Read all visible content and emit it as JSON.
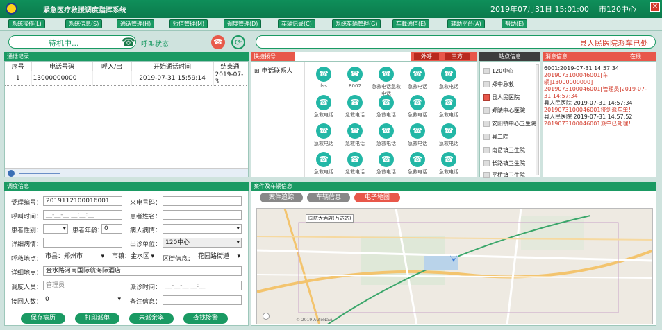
{
  "title_bar": {
    "app_title": "紧急医疗救援调度指挥系统",
    "datetime": "2019年07月31日 15:01:00",
    "center": "市120中心",
    "close_glyph": "✕"
  },
  "menu": [
    "系统操作(L)",
    "系统信息(S)",
    "通话管理(H)",
    "短信管理(M)",
    "调度管理(D)",
    "车辆记录(C)",
    "系统车辆管理(G)",
    "车载通信(E)",
    "辅助平台(A)",
    "帮助(E)"
  ],
  "status": {
    "waiting_text": "待机中...",
    "call_state": "呼叫状态",
    "notice": "县人民医院派车已处",
    "phone_icon": "☎",
    "hangup_icon": "☎",
    "refresh_icon": "⟳"
  },
  "call_records": {
    "header": "通话记录",
    "columns": [
      "序号",
      "电话号码",
      "呼入/出",
      "开始通话时间",
      "结束通"
    ],
    "rows": [
      {
        "no": "1",
        "phone": "13000000000",
        "direction": "",
        "start": "2019-07-31 15:59:14",
        "end": "2019-07-3"
      }
    ]
  },
  "quick_dial": {
    "label": "快捷拨号",
    "btn_out": "外呼",
    "btn_three": "三方",
    "contacts_label": "电话联系人",
    "items": [
      "fss",
      "8002",
      "急救电话急救电话",
      "急救电话",
      "急救电话",
      "急救电话",
      "急救电话",
      "急救电话",
      "急救电话",
      "急救电话",
      "急救电话",
      "急救电话",
      "急救电话",
      "急救电话",
      "急救电话",
      "急救电话",
      "急救电话",
      "急救电话",
      "急救电话",
      "急救电话"
    ]
  },
  "duty": {
    "header": "站点信息",
    "items": [
      "120中心",
      "郑中急救",
      "县人民医院",
      "郑陵中心医院",
      "安阳镇中心卫生院",
      "县二院",
      "南岳镇卫生院",
      "长路镇卫生院",
      "平桥镇卫生院"
    ]
  },
  "messages": {
    "header": "消息信息",
    "online": "在线",
    "lines": [
      {
        "text": "6001:2019-07-31 14:57:34",
        "kind": "b"
      },
      {
        "text": "2019073100046001[车辆]13000000000]",
        "kind": "r"
      },
      {
        "text": "2019073100046001[管理员]2019-07-",
        "kind": "r"
      },
      {
        "text": "31 14:57:34",
        "kind": "r"
      },
      {
        "text": "县人民医院 2019-07-31 14:57:34",
        "kind": "b"
      },
      {
        "text": "2019073100046001接到派车单！",
        "kind": "r"
      },
      {
        "text": "县人民医院 2019-07-31 14:57:52",
        "kind": "b"
      },
      {
        "text": "2019073100046001派单已处理！",
        "kind": "r"
      }
    ]
  },
  "dispatch": {
    "header": "调度信息",
    "accept_no_label": "受理编号：",
    "accept_no": "2019112100016001",
    "caller_phone_label": "来电号码：",
    "call_time_label": "呼叫时间：",
    "call_time": "__-__-__ __:__:__",
    "patient_name_label": "患者姓名：",
    "gender_label": "患者性别：",
    "gender": "",
    "age_label": "患者年龄：",
    "age": "0",
    "condition_label": "病人病情：",
    "detail_label": "详细病情：",
    "unit_label": "出诊单位：",
    "unit": "120中心",
    "addr_label": "呼救地点：",
    "county": "市县：郑州市",
    "town": "市镇：金水区",
    "street_label": "区街信息：",
    "street": "花园路街道",
    "detail_addr_label": "详细地点：",
    "detail_addr": "金水路河南国际航海际酒店",
    "dispatcher_label": "调度人员：",
    "dispatcher": "管理员",
    "dispatch_time_label": "派诊时间：",
    "dispatch_time": "__-__-__ __:__",
    "count_label": "接回人数：",
    "count": "0",
    "remark_label": "备注信息：",
    "btn_save": "保存病历",
    "btn_print": "打印派单",
    "btn_free": "未派余率",
    "btn_find": "查找接警"
  },
  "map_panel": {
    "header": "案件及车辆信息",
    "tab_case": "案件追踪",
    "tab_vehicle": "车辆信息",
    "tab_map": "电子地图",
    "map_label": "国航大酒店(万达站)",
    "credit": "© 2019 AutoNavi"
  },
  "colors": {
    "brand_green": "#1a9a63",
    "alert_red": "#e8574a",
    "dial_teal": "#23b7a6"
  }
}
